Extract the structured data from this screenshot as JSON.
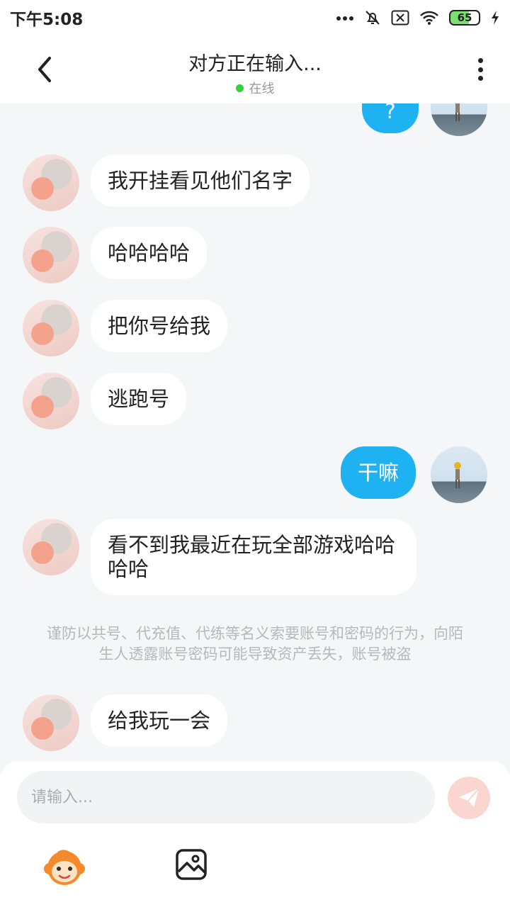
{
  "status_bar": {
    "time": "下午5:08",
    "battery": "65"
  },
  "header": {
    "title": "对方正在输入...",
    "status": "在线"
  },
  "messages": [
    {
      "side": "right",
      "text": "?"
    },
    {
      "side": "left",
      "text": "我开挂看见他们名字"
    },
    {
      "side": "left",
      "text": "哈哈哈哈"
    },
    {
      "side": "left",
      "text": "把你号给我"
    },
    {
      "side": "left",
      "text": "逃跑号"
    },
    {
      "side": "right",
      "text": "干嘛"
    },
    {
      "side": "left",
      "text": "看不到我最近在玩全部游戏哈哈哈哈"
    },
    {
      "side": "left",
      "text": "给我玩一会"
    }
  ],
  "notice": "谨防以共号、代充值、代练等名义索要账号和密码的行为，向陌生人透露账号密码可能导致资产丢失，账号被盗",
  "composer": {
    "placeholder": "请输入..."
  },
  "colors": {
    "accent": "#1fb2f3",
    "online": "#2fd43a",
    "send_disabled": "#fbd6d0"
  }
}
